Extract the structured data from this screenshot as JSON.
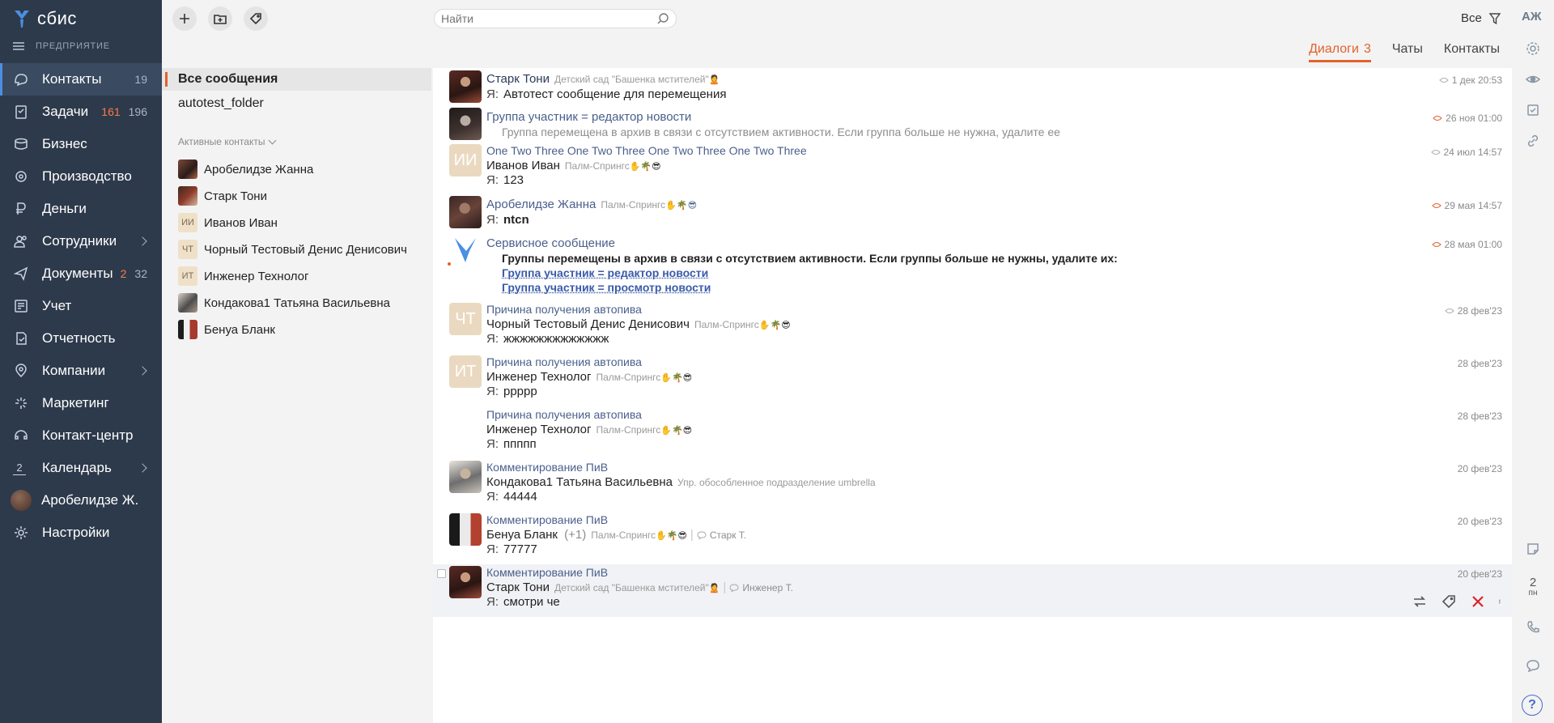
{
  "app": {
    "logo": "сбис",
    "company": "ПРЕДПРИЯТИЕ",
    "user_initials": "АЖ"
  },
  "nav": [
    {
      "label": "Контакты",
      "icon": "contacts-icon",
      "count": "19",
      "active": true
    },
    {
      "label": "Задачи",
      "icon": "tasks-icon",
      "count_red": "161",
      "count": "196"
    },
    {
      "label": "Бизнес",
      "icon": "business-icon"
    },
    {
      "label": "Производство",
      "icon": "production-icon"
    },
    {
      "label": "Деньги",
      "icon": "money-icon"
    },
    {
      "label": "Сотрудники",
      "icon": "employees-icon",
      "chevron": true
    },
    {
      "label": "Документы",
      "icon": "documents-icon",
      "count_red": "2",
      "count": "32"
    },
    {
      "label": "Учет",
      "icon": "accounting-icon"
    },
    {
      "label": "Отчетность",
      "icon": "reports-icon"
    },
    {
      "label": "Компании",
      "icon": "companies-icon",
      "chevron": true
    },
    {
      "label": "Маркетинг",
      "icon": "marketing-icon"
    },
    {
      "label": "Контакт-центр",
      "icon": "contact-center-icon"
    },
    {
      "label": "Календарь",
      "icon": "calendar-icon",
      "chevron": true,
      "day": "2"
    },
    {
      "label": "Аробелидзе Ж.",
      "icon": "user-avatar"
    },
    {
      "label": "Настройки",
      "icon": "settings-icon"
    }
  ],
  "search": {
    "placeholder": "Найти"
  },
  "filter": {
    "label": "Все"
  },
  "tabs": [
    {
      "label": "Диалоги",
      "count": "3",
      "active": true
    },
    {
      "label": "Чаты"
    },
    {
      "label": "Контакты"
    }
  ],
  "folders": [
    {
      "label": "Все сообщения",
      "active": true
    },
    {
      "label": "autotest_folder"
    }
  ],
  "active_contacts": {
    "title": "Активные контакты",
    "items": [
      {
        "name": "Аробелидзе Жанна",
        "avatar": "photo"
      },
      {
        "name": "Старк Тони",
        "avatar": "photo"
      },
      {
        "name": "Иванов Иван",
        "avatar": "ИИ"
      },
      {
        "name": "Чорный Тестовый Денис Денисович",
        "avatar": "ЧТ"
      },
      {
        "name": "Инженер Технолог",
        "avatar": "ИТ"
      },
      {
        "name": "Кондакова1 Татьяна Васильевна",
        "avatar": "photo"
      },
      {
        "name": "Бенуа Бланк",
        "avatar": "photo"
      }
    ]
  },
  "me_prefix": "Я:",
  "emojis": "✋🌴😎",
  "dialogs": [
    {
      "title": "Старк Тони",
      "sub": "Детский сад \"Башенка мстителей\"",
      "emoji": "🙎",
      "text": "Автотест сообщение для перемещения",
      "date": "1 дек 20:53",
      "eye": "gray"
    },
    {
      "title": "Группа участник = редактор новости",
      "text": "Группа перемещена в архив в связи с отсутствием активности. Если группа больше не нужна, удалите ее",
      "date": "26 ноя 01:00",
      "eye": "orange"
    },
    {
      "title": "One Two Three One Two Three One Two Three One Two Three",
      "person": "Иванов Иван",
      "sub": "Палм-Спрингс",
      "text": "123",
      "date": "24 июл 14:57",
      "eye": "gray",
      "avatar": "ИИ"
    },
    {
      "title": "Аробелидзе Жанна",
      "sub": "Палм-Спрингс",
      "text": "ntcn",
      "date": "29 мая 14:57",
      "eye": "orange"
    },
    {
      "title": "Сервисное сообщение",
      "text": "Группы перемещены в архив в связи с отсутствием активности. Если группы больше не нужны, удалите их:",
      "link1": "Группа участник = редактор новости",
      "link2": "Группа участник = просмотр новости",
      "date": "28 мая 01:00",
      "eye": "orange"
    },
    {
      "title": "Причина получения автопива",
      "person": "Чорный Тестовый Денис Денисович",
      "sub": "Палм-Спрингс",
      "text": "жжжжжжжжжжжжж",
      "date": "28 фев'23",
      "eye": "gray",
      "avatar": "ЧТ"
    },
    {
      "title": "Причина получения автопива",
      "person": "Инженер Технолог",
      "sub": "Палм-Спрингс",
      "text": "ррррр",
      "date": "28 фев'23",
      "avatar": "ИТ"
    },
    {
      "title": "Причина получения автопива",
      "person": "Инженер Технолог",
      "sub": "Палм-Спрингс",
      "text": "ппппп",
      "date": "28 фев'23"
    },
    {
      "title": "Комментирование ПиВ",
      "person": "Кондакова1 Татьяна Васильевна",
      "sub": "Упр. обособленное подразделение umbrella",
      "text": "44444",
      "date": "20 фев'23"
    },
    {
      "title": "Комментирование ПиВ",
      "person": "Бенуа Бланк",
      "extra": "(+1)",
      "sub": "Палм-Спрингс",
      "comment": "Старк Т.",
      "text": "77777",
      "date": "20 фев'23"
    },
    {
      "title": "Комментирование ПиВ",
      "person": "Старк Тони",
      "sub": "Детский сад \"Башенка мстителей\"",
      "emoji": "🙎",
      "comment": "Инженер Т.",
      "text": "смотри че",
      "date": "20 фев'23"
    }
  ]
}
